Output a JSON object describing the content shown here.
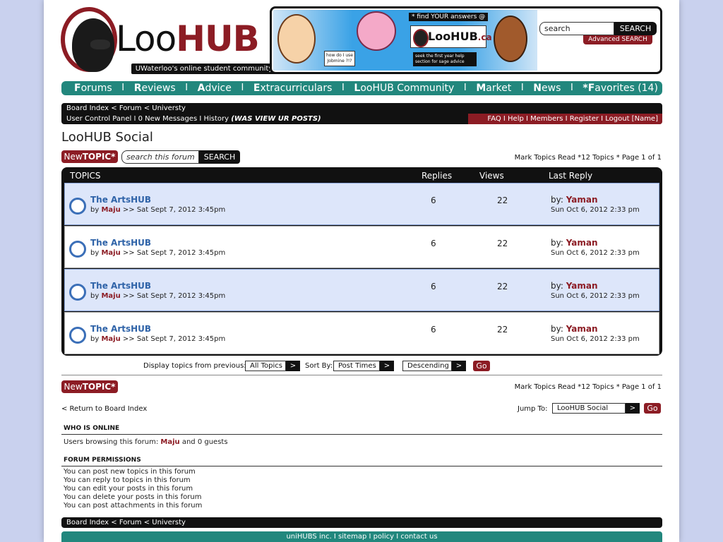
{
  "header": {
    "logo_loo": "Loo",
    "logo_hub": "HUB",
    "tagline": "UWaterloo's online student community",
    "search_placeholder": "search",
    "search_button": "SEARCH",
    "advanced_search": "Advanced SEARCH",
    "banner": {
      "find_text": "* find YOUR answers @",
      "logo_text": "LooHUB",
      "logo_ca": ".ca",
      "note_text": "how do I use Jobmine ?!?",
      "seek_text": "seek the first year help section for sage advice"
    }
  },
  "nav": {
    "items": [
      {
        "first": "F",
        "rest": "orums"
      },
      {
        "first": "R",
        "rest": "eviews"
      },
      {
        "first": "A",
        "rest": "dvice"
      },
      {
        "first": "E",
        "rest": "xtracurriculars"
      },
      {
        "first": "L",
        "rest": "ooHUB Community"
      },
      {
        "first": "M",
        "rest": "arket"
      },
      {
        "first": "N",
        "rest": "ews"
      },
      {
        "first": "*F",
        "rest": "avorites (14)"
      }
    ],
    "separator": "I"
  },
  "breadcrumb": "Board Index < Forum < Universty",
  "ucp": {
    "left": "User Control Panel  I  0 New Messages  I  History",
    "left_italic": "(WAS VIEW UR POSTS)",
    "right": "FAQ  I  Help  I  Members  I  Register  I Logout [Name]"
  },
  "forum": {
    "title": "LooHUB Social",
    "new_topic_prefix": "New",
    "new_topic_bold": "TOPIC*",
    "search_placeholder": "search this forum",
    "search_button": "SEARCH",
    "page_info": "Mark Topics Read *12 Topics * Page 1 of 1"
  },
  "table": {
    "headers": {
      "topics": "TOPICS",
      "replies": "Replies",
      "views": "Views",
      "last": "Last Reply"
    },
    "rows": [
      {
        "title": "The ArtsHUB",
        "by": "by",
        "author": "Maju",
        "date": ">> Sat Sept 7, 2012 3:45pm",
        "replies": "6",
        "views": "22",
        "last_by": "by:",
        "last_who": "Yaman",
        "last_when": "Sun Oct 6, 2012  2:33 pm"
      },
      {
        "title": "The ArtsHUB",
        "by": "by",
        "author": "Maju",
        "date": ">> Sat Sept 7, 2012 3:45pm",
        "replies": "6",
        "views": "22",
        "last_by": "by:",
        "last_who": "Yaman",
        "last_when": "Sun Oct 6, 2012  2:33 pm"
      },
      {
        "title": "The ArtsHUB",
        "by": "by",
        "author": "Maju",
        "date": ">> Sat Sept 7, 2012 3:45pm",
        "replies": "6",
        "views": "22",
        "last_by": "by:",
        "last_who": "Yaman",
        "last_when": "Sun Oct 6, 2012  2:33 pm"
      },
      {
        "title": "The ArtsHUB",
        "by": "by",
        "author": "Maju",
        "date": ">> Sat Sept 7, 2012 3:45pm",
        "replies": "6",
        "views": "22",
        "last_by": "by:",
        "last_who": "Yaman",
        "last_when": "Sun Oct 6, 2012  2:33 pm"
      }
    ]
  },
  "display": {
    "label": "Display topics from previous:",
    "topics_value": "All Topics",
    "sort_label": "Sort By:",
    "sort_value": "Post Times",
    "order_value": "Descending",
    "arrow": ">",
    "go": "Go"
  },
  "bottom": {
    "return": "< Return to Board Index",
    "jump_label": "Jump To:",
    "jump_value": "LooHUB Social"
  },
  "online": {
    "heading": "WHO IS ONLINE",
    "text_prefix": "Users browsing this forum:",
    "user": "Maju",
    "text_suffix": "and 0 guests"
  },
  "permissions": {
    "heading": "FORUM PERMISSIONS",
    "lines": [
      "You can post new topics in this forum",
      "You can reply to topics in this forum",
      "You can edit your posts in this forum",
      "You can delete your posts in this forum",
      "You can post attachments in this forum"
    ]
  },
  "footer": "uniHUBS inc. I sitemap I policy I contact us",
  "colors": {
    "brand_red": "#8c1c24",
    "teal": "#22877d",
    "link_blue": "#2f63a8",
    "page_bg": "#c9d1ee"
  }
}
